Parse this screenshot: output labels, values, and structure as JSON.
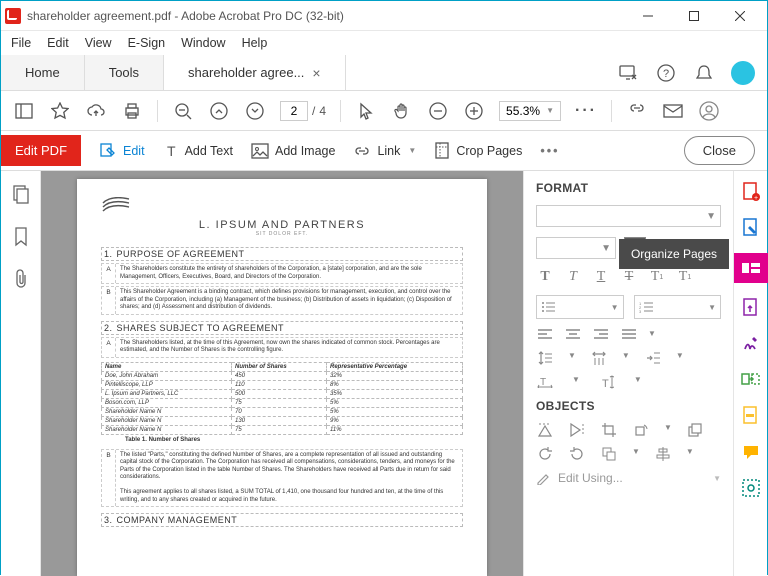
{
  "window": {
    "title": "shareholder agreement.pdf - Adobe Acrobat Pro DC (32-bit)"
  },
  "menu": [
    "File",
    "Edit",
    "View",
    "E-Sign",
    "Window",
    "Help"
  ],
  "tabs": {
    "home": "Home",
    "tools": "Tools",
    "doc": "shareholder agree..."
  },
  "toolbar": {
    "page_current": "2",
    "page_sep": "/",
    "page_total": "4",
    "zoom": "55.3%",
    "more": "···"
  },
  "edit_bar": {
    "title": "Edit PDF",
    "edit": "Edit",
    "add_text": "Add Text",
    "add_image": "Add Image",
    "link": "Link",
    "crop": "Crop Pages",
    "close": "Close"
  },
  "document": {
    "firm_name": "L. IPSUM AND PARTNERS",
    "firm_sub": "SIT DOLOR EFT.",
    "s1_title": "PURPOSE OF AGREEMENT",
    "s1_num": "1.",
    "s1_a": "The Shareholders constitute the entirety of shareholders of the Corporation, a [state] corporation, and are the sole Management, Officers, Executives, Board, and Directors of the Corporation.",
    "s1_b": "This Shareholder Agreement is a binding contract, which defines provisions for management, execution, and control over the affairs of the Corporation, including (a) Management of the business; (b) Distribution of assets in liquidation; (c) Disposition of shares; and (d) Assessment and distribution of dividends.",
    "s2_title": "SHARES SUBJECT TO AGREEMENT",
    "s2_num": "2.",
    "s2_a": "The Shareholders listed, at the time of this Agreement, now own the shares indicated of common stock. Percentages are estimated, and the Number of Shares is the controlling figure.",
    "table": {
      "headers": [
        "Name",
        "Number of Shares",
        "Representative Percentage"
      ],
      "rows": [
        [
          "Doe, John Abraham",
          "450",
          "32%"
        ],
        [
          "Pintelliscope, LLP",
          "110",
          "8%"
        ],
        [
          "L. Ipsum and Partners, LLC",
          "500",
          "35%"
        ],
        [
          "Boson.com, LLP",
          "75",
          "5%"
        ],
        [
          "Shareholder Name N",
          "70",
          "5%"
        ],
        [
          "Shareholder Name N",
          "130",
          "9%"
        ],
        [
          "Shareholder Name N",
          "75",
          "11%"
        ]
      ],
      "caption": "Table 1. Number of Shares"
    },
    "s2_b": "The listed \"Parts,\" constituting the defined Number of Shares, are a complete representation of all issued and outstanding capital stock of the Corporation. The Corporation has received all compensations, considerations, tenders, and moneys for the Parts of the Corporation listed in the table Number of Shares. The Shareholders have received all Parts due in return for said considerations.",
    "s2_c": "This agreement applies to all shares listed, a SUM TOTAL of 1,410, one thousand four hundred and ten, at the time of this writing, and to any shares created or acquired in the future.",
    "s3_title": "COMPANY MANAGEMENT",
    "s3_num": "3."
  },
  "format_panel": {
    "title": "FORMAT",
    "objects": "OBJECTS",
    "edit_using": "Edit Using..."
  },
  "tooltip": "Organize Pages",
  "right_tools": {
    "colors": {
      "create": "#e1251b",
      "edit": "#1976d2",
      "active": "#e1008c",
      "export": "#8e24aa",
      "sign": "#7b1fa2",
      "organize": "#43a047",
      "redact": "#fbc02d",
      "comment": "#ffb300",
      "more": "#00897b"
    }
  }
}
